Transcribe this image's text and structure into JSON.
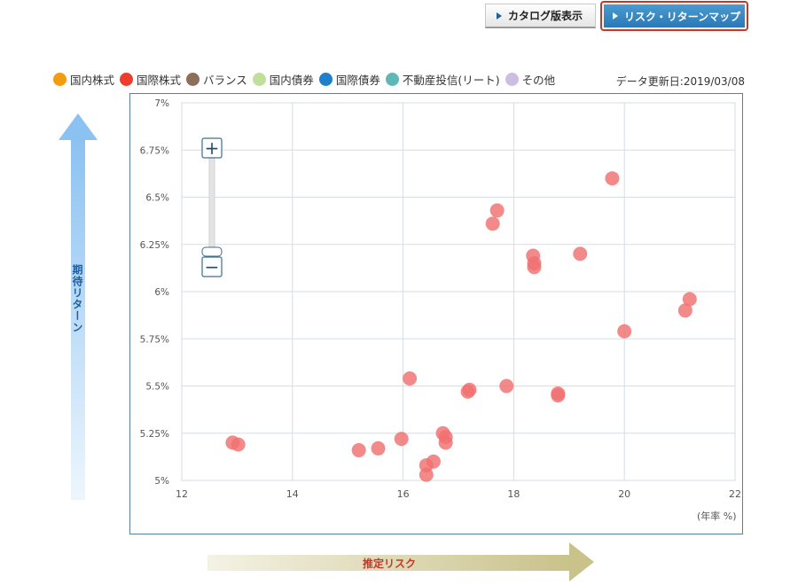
{
  "view_toggle": {
    "catalog_label": "カタログ版表示",
    "riskmap_label": "リスク・リターンマップ"
  },
  "legend": [
    {
      "label": "国内株式",
      "color": "#f39c12"
    },
    {
      "label": "国際株式",
      "color": "#f03c2c"
    },
    {
      "label": "バランス",
      "color": "#8e6e5a"
    },
    {
      "label": "国内債券",
      "color": "#bfe09a"
    },
    {
      "label": "国際債券",
      "color": "#1f7fc9"
    },
    {
      "label": "不動産投信(リート)",
      "color": "#5fb8b8"
    },
    {
      "label": "その他",
      "color": "#cdbde0"
    }
  ],
  "update_date": "データ更新日:2019/03/08",
  "y_axis_title": "期待リターン",
  "x_axis_title": "推定リスク",
  "x_unit": "(年率 %)",
  "zoom": {
    "plus_label": "+",
    "minus_label": "−"
  },
  "chart_data": {
    "type": "scatter",
    "xlim": [
      12,
      22
    ],
    "ylim": [
      5.0,
      7.0
    ],
    "x_ticks": [
      12,
      14,
      16,
      18,
      20,
      22
    ],
    "y_ticks": [
      5.0,
      5.25,
      5.5,
      5.75,
      6.0,
      6.25,
      6.5,
      6.75,
      7.0
    ],
    "y_tick_labels": [
      "5%",
      "5.25%",
      "5.5%",
      "5.75%",
      "6%",
      "6.25%",
      "6.5%",
      "6.75%",
      "7%"
    ],
    "grid": true,
    "series": [
      {
        "color": "#f07070",
        "points": [
          {
            "x": 12.92,
            "y": 5.2
          },
          {
            "x": 13.02,
            "y": 5.19
          },
          {
            "x": 15.2,
            "y": 5.16
          },
          {
            "x": 15.55,
            "y": 5.17
          },
          {
            "x": 15.97,
            "y": 5.22
          },
          {
            "x": 16.12,
            "y": 5.54
          },
          {
            "x": 16.42,
            "y": 5.03
          },
          {
            "x": 16.42,
            "y": 5.08
          },
          {
            "x": 16.55,
            "y": 5.1
          },
          {
            "x": 16.72,
            "y": 5.25
          },
          {
            "x": 16.77,
            "y": 5.2
          },
          {
            "x": 16.77,
            "y": 5.23
          },
          {
            "x": 17.17,
            "y": 5.47
          },
          {
            "x": 17.2,
            "y": 5.48
          },
          {
            "x": 17.62,
            "y": 6.36
          },
          {
            "x": 17.7,
            "y": 6.43
          },
          {
            "x": 17.87,
            "y": 5.5
          },
          {
            "x": 18.35,
            "y": 6.19
          },
          {
            "x": 18.37,
            "y": 6.13
          },
          {
            "x": 18.37,
            "y": 6.15
          },
          {
            "x": 18.8,
            "y": 5.45
          },
          {
            "x": 18.8,
            "y": 5.46
          },
          {
            "x": 19.2,
            "y": 6.2
          },
          {
            "x": 19.78,
            "y": 6.6
          },
          {
            "x": 20.0,
            "y": 5.79
          },
          {
            "x": 21.1,
            "y": 5.9
          },
          {
            "x": 21.18,
            "y": 5.96
          }
        ]
      }
    ]
  }
}
